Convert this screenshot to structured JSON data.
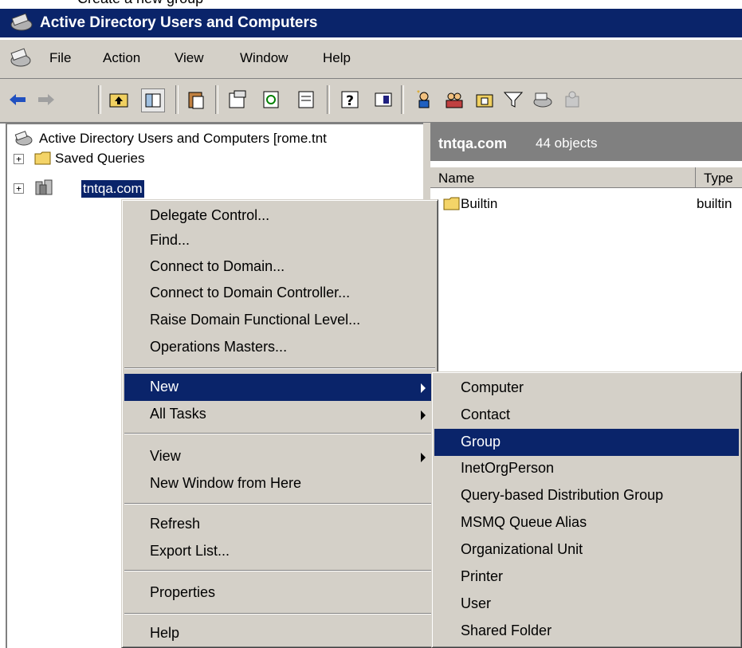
{
  "caption": "Create a new group",
  "window": {
    "title": "Active Directory Users and Computers"
  },
  "menubar": [
    "File",
    "Action",
    "View",
    "Window",
    "Help"
  ],
  "toolbar_icons": [
    "back-icon",
    "forward-icon",
    "up-folder-icon",
    "show-hide-tree-icon",
    "paste-icon",
    "properties-icon",
    "refresh-icon",
    "export-list-icon",
    "help-icon",
    "view-icon",
    "new-user-icon",
    "new-group-icon",
    "new-ou-icon",
    "filter-icon",
    "find-icon",
    "add-to-group-icon"
  ],
  "tree": {
    "root": "Active Directory Users and Computers [rome.tnt",
    "items": [
      "Saved Queries",
      "tntqa.com"
    ]
  },
  "rightpane": {
    "domain": "tntqa.com",
    "count": "44 objects",
    "columns": [
      "Name",
      "Type"
    ],
    "rows": [
      {
        "name": "Builtin",
        "type": "builtin"
      }
    ]
  },
  "context_menu": {
    "items": [
      "Delegate Control...",
      "Find...",
      "Connect to Domain...",
      "Connect to Domain Controller...",
      "Raise Domain Functional Level...",
      "Operations Masters...",
      "New",
      "All Tasks",
      "View",
      "New Window from Here",
      "Refresh",
      "Export List...",
      "Properties",
      "Help"
    ]
  },
  "submenu": {
    "items": [
      "Computer",
      "Contact",
      "Group",
      "InetOrgPerson",
      "Query-based Distribution Group",
      "MSMQ Queue Alias",
      "Organizational Unit",
      "Printer",
      "User",
      "Shared Folder"
    ]
  },
  "colors": {
    "titlebar": "#0a246a",
    "face": "#d4d0c8",
    "highlight": "#0a246a",
    "header": "#808080"
  }
}
